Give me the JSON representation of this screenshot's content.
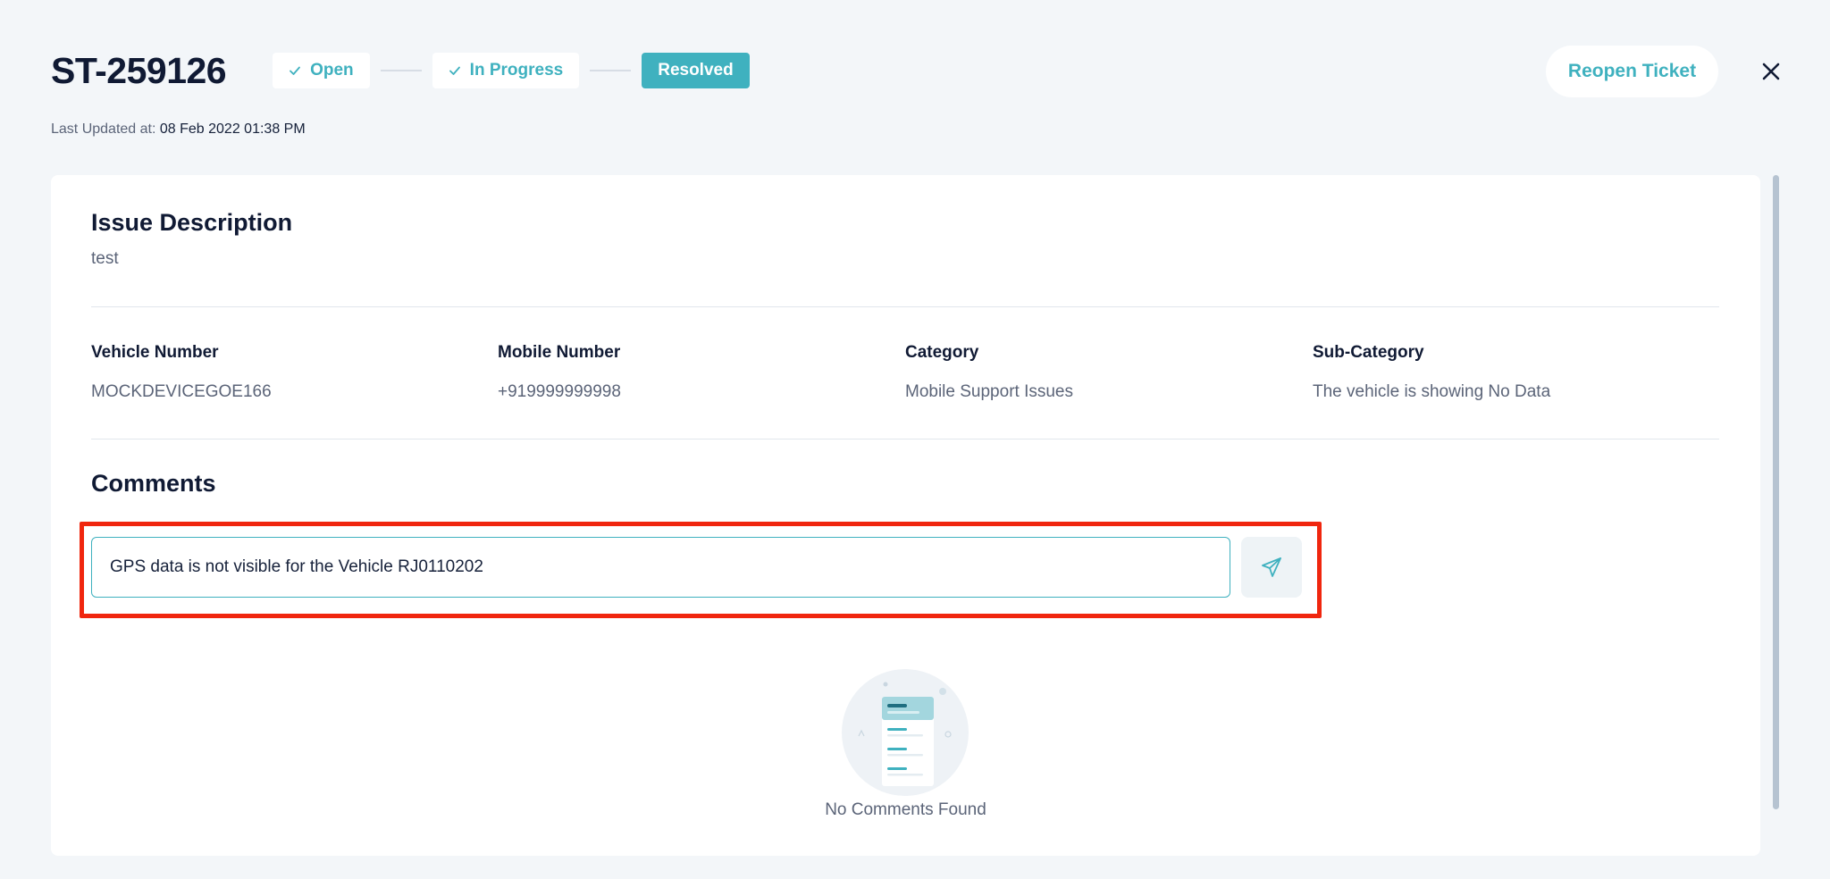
{
  "ticket": {
    "id": "ST-259126",
    "last_updated_label": "Last Updated at:",
    "last_updated_value": "08 Feb 2022 01:38 PM"
  },
  "steps": [
    {
      "label": "Open",
      "done": true
    },
    {
      "label": "In Progress",
      "done": true
    },
    {
      "label": "Resolved",
      "active": true
    }
  ],
  "actions": {
    "reopen_label": "Reopen Ticket"
  },
  "issue": {
    "title": "Issue Description",
    "text": "test"
  },
  "details": [
    {
      "label": "Vehicle Number",
      "value": "MOCKDEVICEGOE166"
    },
    {
      "label": "Mobile Number",
      "value": "+919999999998"
    },
    {
      "label": "Category",
      "value": "Mobile Support Issues"
    },
    {
      "label": "Sub-Category",
      "value": "The vehicle is showing No Data"
    }
  ],
  "comments": {
    "title": "Comments",
    "input_value": "GPS data is not visible for the Vehicle RJ0110202",
    "empty_text": "No Comments Found"
  },
  "colors": {
    "accent": "#3fb1bf",
    "highlight": "#f0260e",
    "background": "#f3f6f9"
  },
  "icons": {
    "check": "check-icon",
    "close": "close-icon",
    "send": "send-icon",
    "empty": "empty-comments-illustration"
  }
}
